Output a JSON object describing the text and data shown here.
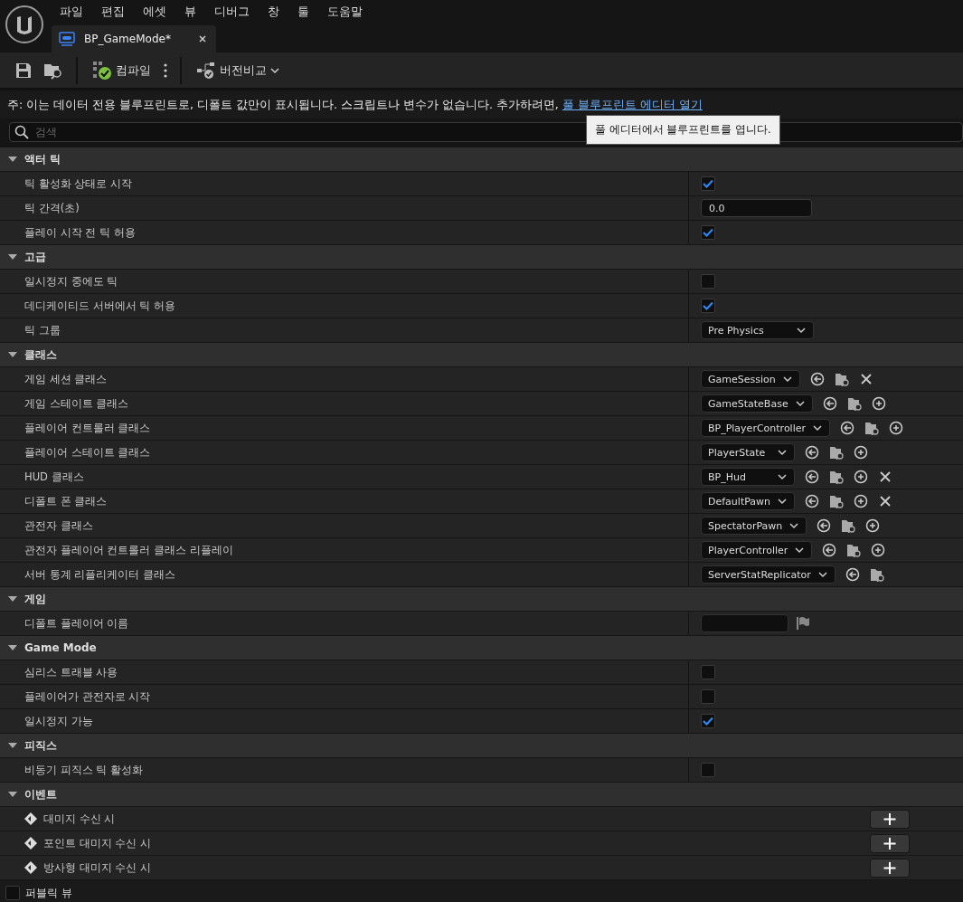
{
  "menu": [
    "파일",
    "편집",
    "에셋",
    "뷰",
    "디버그",
    "창",
    "툴",
    "도움말"
  ],
  "tab": {
    "title": "BP_GameMode*"
  },
  "toolbar": {
    "compile": "컴파일",
    "diff": "버전비교"
  },
  "notice": {
    "text": "주: 이는 데이터 전용 블루프린트로, 디폴트 값만이 표시됩니다. 스크립트나 변수가 없습니다. 추가하려면,",
    "link": "풀 블루프린트 에디터 열기"
  },
  "tooltip": "풀 에디터에서 블루프린트를 엽니다.",
  "search": {
    "placeholder": "검색"
  },
  "sections": [
    {
      "title": "액터 틱",
      "expanded": true,
      "rows": [
        {
          "kind": "checkbox",
          "label": "틱 활성화 상태로 시작",
          "checked": true
        },
        {
          "kind": "number",
          "label": "틱 간격(초)",
          "value": "0.0"
        },
        {
          "kind": "checkbox",
          "label": "플레이 시작 전 틱 허용",
          "checked": true
        }
      ]
    },
    {
      "title": "고급",
      "expanded": true,
      "rows": [
        {
          "kind": "checkbox",
          "label": "일시정지 중에도 틱",
          "checked": false
        },
        {
          "kind": "checkbox",
          "label": "데디케이티드 서버에서 틱 허용",
          "checked": true
        },
        {
          "kind": "dropdown",
          "label": "틱 그룹",
          "value": "Pre Physics"
        }
      ]
    },
    {
      "title": "클래스",
      "expanded": true,
      "rows": [
        {
          "kind": "class",
          "label": "게임 세션 클래스",
          "value": "GameSession",
          "actions": [
            {
              "kind": "use"
            },
            {
              "kind": "browse"
            },
            {
              "kind": "clear"
            }
          ]
        },
        {
          "kind": "class",
          "label": "게임 스테이트 클래스",
          "value": "GameStateBase",
          "actions": [
            {
              "kind": "use"
            },
            {
              "kind": "browse"
            },
            {
              "kind": "add"
            }
          ]
        },
        {
          "kind": "class",
          "label": "플레이어 컨트롤러 클래스",
          "value": "BP_PlayerController",
          "actions": [
            {
              "kind": "use"
            },
            {
              "kind": "browse"
            },
            {
              "kind": "add"
            }
          ]
        },
        {
          "kind": "class",
          "label": "플레이어 스테이트 클래스",
          "value": "PlayerState",
          "actions": [
            {
              "kind": "use"
            },
            {
              "kind": "browse"
            },
            {
              "kind": "add"
            }
          ]
        },
        {
          "kind": "class",
          "label": "HUD 클래스",
          "value": "BP_Hud",
          "actions": [
            {
              "kind": "use"
            },
            {
              "kind": "browse"
            },
            {
              "kind": "add"
            },
            {
              "kind": "clear"
            }
          ]
        },
        {
          "kind": "class",
          "label": "디폴트 폰 클래스",
          "value": "DefaultPawn",
          "actions": [
            {
              "kind": "use"
            },
            {
              "kind": "browse"
            },
            {
              "kind": "add"
            },
            {
              "kind": "clear"
            }
          ]
        },
        {
          "kind": "class",
          "label": "관전자 클래스",
          "value": "SpectatorPawn",
          "actions": [
            {
              "kind": "use"
            },
            {
              "kind": "browse"
            },
            {
              "kind": "add"
            }
          ]
        },
        {
          "kind": "class",
          "label": "관전자 플레이어 컨트롤러 클래스 리플레이",
          "value": "PlayerController",
          "actions": [
            {
              "kind": "use"
            },
            {
              "kind": "browse"
            },
            {
              "kind": "add"
            }
          ]
        },
        {
          "kind": "class",
          "label": "서버 통계 리플리케이터 클래스",
          "value": "ServerStatReplicator",
          "actions": [
            {
              "kind": "use"
            },
            {
              "kind": "browse"
            }
          ]
        }
      ]
    },
    {
      "title": "게임",
      "expanded": true,
      "rows": [
        {
          "kind": "name",
          "label": "디폴트 플레이어 이름"
        }
      ]
    },
    {
      "title": "Game Mode",
      "expanded": true,
      "rows": [
        {
          "kind": "checkbox",
          "label": "심리스 트래블 사용",
          "checked": false
        },
        {
          "kind": "checkbox",
          "label": "플레이어가 관전자로 시작",
          "checked": false
        },
        {
          "kind": "checkbox",
          "label": "일시정지 가능",
          "checked": true
        }
      ]
    },
    {
      "title": "피직스",
      "expanded": true,
      "rows": [
        {
          "kind": "checkbox",
          "label": "비동기 피직스 틱 활성화",
          "checked": false
        }
      ]
    },
    {
      "title": "이벤트",
      "expanded": true,
      "rows": [
        {
          "kind": "event",
          "label": "대미지 수신 시"
        },
        {
          "kind": "event",
          "label": "포인트 대미지 수신 시"
        },
        {
          "kind": "event",
          "label": "방사형 대미지 수신 시"
        }
      ]
    }
  ],
  "footer": {
    "label": "퍼블릭 뷰",
    "checked": false
  }
}
